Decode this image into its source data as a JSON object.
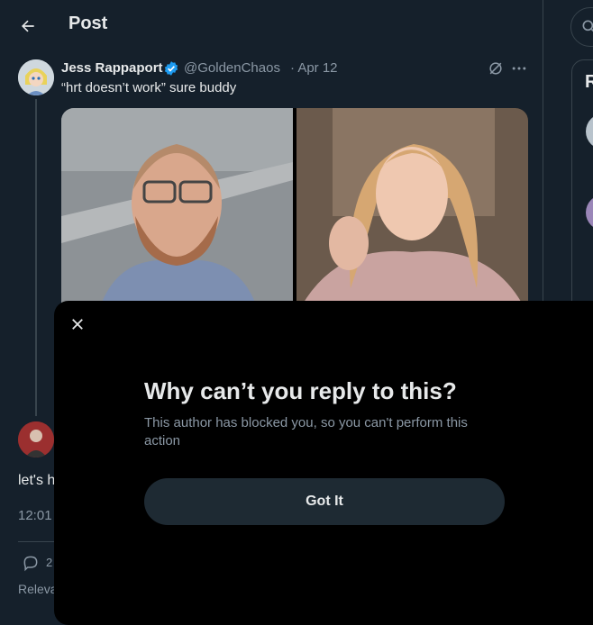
{
  "header": {
    "title": "Post"
  },
  "tweet": {
    "author_name": "Jess Rappaport",
    "handle": "@GoldenChaos",
    "date": "· Apr 12",
    "text": "“hrt doesn’t work” sure buddy"
  },
  "reply": {
    "text_visible": "let's h",
    "time_visible": "12:01",
    "comment_count": "2",
    "sort_label": "Releva"
  },
  "sidebar": {
    "card_title_visible": "R"
  },
  "modal": {
    "title": "Why can’t you reply to this?",
    "description": "This author has blocked you, so you can't perform this action",
    "button_label": "Got It"
  },
  "colors": {
    "background": "#15202b",
    "modal_background": "#000000",
    "button_background": "#1e2a33",
    "verified": "#1d9bf0",
    "text_secondary": "#8b98a5"
  },
  "icons": [
    "back-arrow-icon",
    "verified-badge-icon",
    "grok-icon",
    "more-icon",
    "close-icon",
    "comment-icon",
    "search-icon"
  ]
}
